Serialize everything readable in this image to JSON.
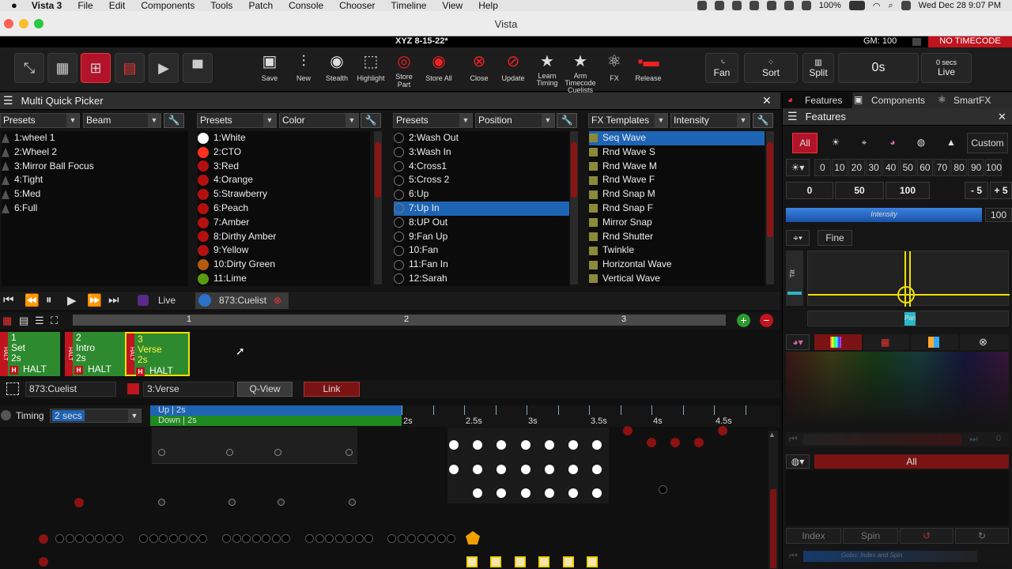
{
  "menubar": {
    "app": "Vista 3",
    "items": [
      "File",
      "Edit",
      "Components",
      "Tools",
      "Patch",
      "Console",
      "Chooser",
      "Timeline",
      "View",
      "Help"
    ],
    "battery": "100%",
    "clock": "Wed Dec 28  9:07 PM"
  },
  "window": {
    "title": "Vista"
  },
  "showbar": {
    "show_name": "XYZ 8-15-22*",
    "gm": "GM: 100",
    "timecode": "NO TIMECODE"
  },
  "toolbar": {
    "buttons": [
      "Save",
      "New",
      "Stealth",
      "Highlight",
      "Store Part",
      "Store All",
      "Close",
      "Update",
      "Learn Timing",
      "Arm Timecode Cuelists",
      "FX",
      "Release"
    ],
    "fan": "Fan",
    "sort": "Sort",
    "split": "Split",
    "time": "0s",
    "secs_label": "0 secs",
    "live": "Live"
  },
  "quick_picker": {
    "title": "Multi Quick Picker",
    "col1": {
      "filter": "Presets",
      "type": "Beam",
      "items": [
        "1:wheel 1",
        "2:Wheel 2",
        "3:Mirror Ball Focus",
        "4:Tight",
        "5:Med",
        "6:Full"
      ]
    },
    "col2": {
      "filter": "Presets",
      "type": "Color",
      "items": [
        "1:White",
        "2:CTO",
        "3:Red",
        "4:Orange",
        "5:Strawberry",
        "6:Peach",
        "7:Amber",
        "8:Dirthy Amber",
        "9:Yellow",
        "10:Dirty Green",
        "11:Lime"
      ],
      "colors": [
        "#ffffff",
        "#ff3020",
        "#b41010",
        "#b41010",
        "#b41010",
        "#b41010",
        "#b41010",
        "#b41010",
        "#b41010",
        "#b45a10",
        "#5a9a10"
      ]
    },
    "col3": {
      "filter": "Presets",
      "type": "Position",
      "items": [
        "2:Wash Out",
        "3:Wash In",
        "4:Cross1",
        "5:Cross 2",
        "6:Up",
        "7:Up In",
        "8:UP Out",
        "9:Fan Up",
        "10:Fan",
        "11:Fan In",
        "12:Sarah"
      ],
      "selected": 5
    },
    "col4": {
      "filter": "FX Templates",
      "type": "Intensity",
      "items": [
        "Seq Wave",
        "Rnd Wave S",
        "Rnd Wave M",
        "Rnd Wave F",
        "Rnd Snap M",
        "Rnd Snap F",
        "Mirror Snap",
        "Rnd Shutter",
        "Twinkle",
        "Horizontal Wave",
        "Vertical Wave"
      ],
      "selected": 0
    }
  },
  "playback": {
    "live": "Live",
    "cuelist": "873:Cuelist",
    "ruler": [
      "1",
      "2",
      "3"
    ]
  },
  "cues": [
    {
      "num": "1",
      "name": "Set",
      "time": "2s",
      "halt": "HALT",
      "h": "H"
    },
    {
      "num": "2",
      "name": "Intro",
      "time": "2s",
      "halt": "HALT",
      "h": "H"
    },
    {
      "num": "3",
      "name": "Verse",
      "time": "2s",
      "halt": "HALT",
      "h": "H"
    }
  ],
  "cuebar": {
    "cuelist": "873:Cuelist",
    "cue": "3:Verse",
    "qview": "Q-View",
    "link": "Link"
  },
  "timing": {
    "label": "Timing",
    "value": "2 secs",
    "up": "Up | 2s",
    "down": "Down | 2s",
    "ticks": [
      "2s",
      "2.5s",
      "3s",
      "3.5s",
      "4s",
      "4.5s"
    ]
  },
  "right_tabs": {
    "features": "Features",
    "components": "Components",
    "smartfx": "SmartFX"
  },
  "features": {
    "title": "Features",
    "filters": {
      "all": "All",
      "custom": "Custom"
    },
    "levels": [
      "0",
      "10",
      "20",
      "30",
      "40",
      "50",
      "60",
      "70",
      "80",
      "90",
      "100"
    ],
    "quick": [
      "0",
      "50",
      "100",
      "- 5",
      "+ 5"
    ],
    "intensity_label": "Intensity",
    "intensity_value": "100",
    "intensity_fraction": 1.0,
    "fine": "Fine",
    "tilt": "Tilt",
    "pan": "Pan",
    "all_btn": "All",
    "index": "Index",
    "spin": "Spin",
    "gobo_label": "Gobo: Index and Spin",
    "dimmed_zero": "0"
  }
}
